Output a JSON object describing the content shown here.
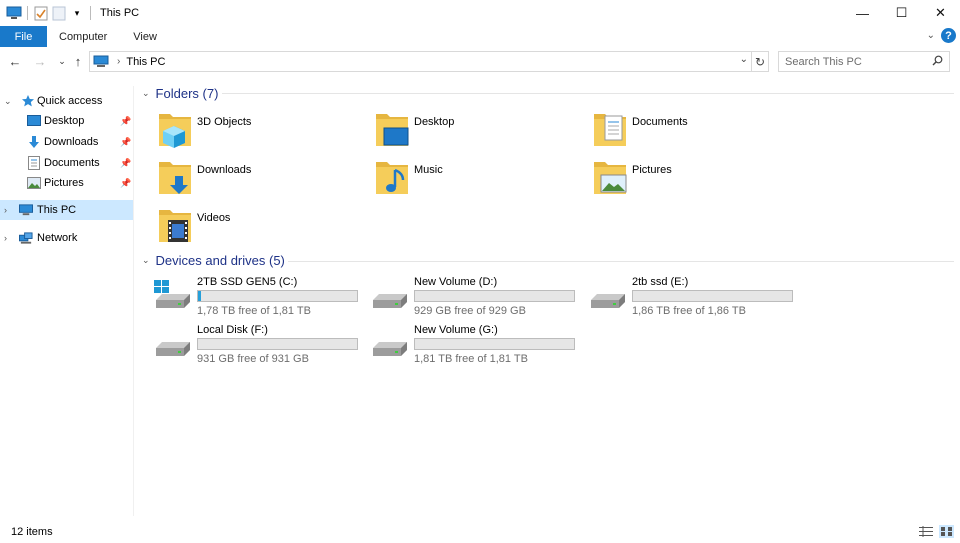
{
  "window": {
    "title": "This PC",
    "controls": {
      "minimize": "—",
      "maximize": "☐",
      "close": "✕"
    }
  },
  "ribbon": {
    "tabs": [
      "File",
      "Computer",
      "View"
    ],
    "help": "?"
  },
  "address": {
    "crumb": "This PC",
    "search_placeholder": "Search This PC"
  },
  "sidebar": {
    "quick_access": "Quick access",
    "pinned": [
      {
        "label": "Desktop",
        "icon": "desktop-icon"
      },
      {
        "label": "Downloads",
        "icon": "download-icon"
      },
      {
        "label": "Documents",
        "icon": "documents-icon"
      },
      {
        "label": "Pictures",
        "icon": "pictures-icon"
      }
    ],
    "this_pc": "This PC",
    "network": "Network"
  },
  "folders": {
    "header": "Folders (7)",
    "items": [
      {
        "name": "3D Objects",
        "icon": "3d-objects-folder-icon"
      },
      {
        "name": "Desktop",
        "icon": "desktop-folder-icon"
      },
      {
        "name": "Documents",
        "icon": "documents-folder-icon"
      },
      {
        "name": "Downloads",
        "icon": "downloads-folder-icon"
      },
      {
        "name": "Music",
        "icon": "music-folder-icon"
      },
      {
        "name": "Pictures",
        "icon": "pictures-folder-icon"
      },
      {
        "name": "Videos",
        "icon": "videos-folder-icon"
      }
    ]
  },
  "drives": {
    "header": "Devices and drives (5)",
    "items": [
      {
        "name": "2TB SSD GEN5 (C:)",
        "free": "1,78 TB free of 1,81 TB",
        "used_fraction": 0.017,
        "windows": true
      },
      {
        "name": "New Volume (D:)",
        "free": "929 GB free of 929 GB",
        "used_fraction": 0.0,
        "windows": false
      },
      {
        "name": "2tb ssd (E:)",
        "free": "1,86 TB free of 1,86 TB",
        "used_fraction": 0.0,
        "windows": false
      },
      {
        "name": "Local Disk (F:)",
        "free": "931 GB free of 931 GB",
        "used_fraction": 0.0,
        "windows": false
      },
      {
        "name": "New Volume (G:)",
        "free": "1,81 TB free of 1,81 TB",
        "used_fraction": 0.0,
        "windows": false
      }
    ]
  },
  "status": {
    "count": "12 items"
  },
  "colors": {
    "accent": "#1979ca",
    "header": "#1e3287",
    "selection": "#cce8ff",
    "folder": "#f5cd5a"
  }
}
